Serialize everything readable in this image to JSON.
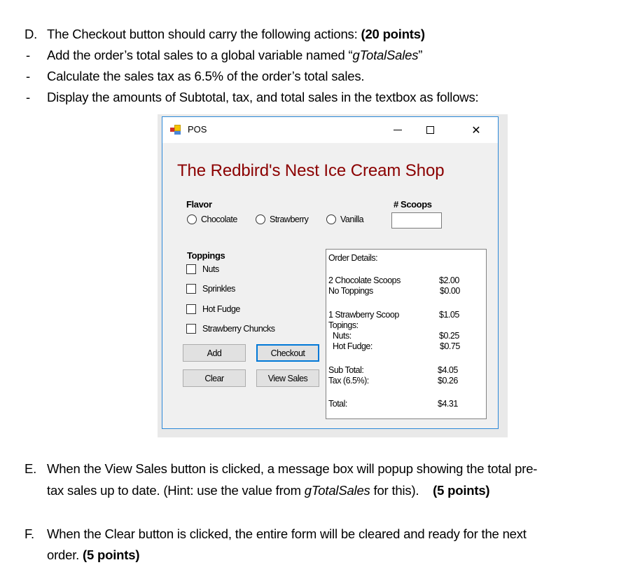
{
  "document": {
    "section_d": {
      "marker": "D.",
      "text": "The Checkout button should carry the following actions: ",
      "points": "(20 points)",
      "bullets": [
        {
          "marker": "-",
          "text_before": "Add the order’s total sales to a global variable named “",
          "italic": "gTotalSales",
          "text_after": "”"
        },
        {
          "marker": "-",
          "text": "Calculate the sales tax as 6.5% of the order’s total sales."
        },
        {
          "marker": "-",
          "text": "Display the amounts of Subtotal, tax, and total sales in the textbox as follows:"
        }
      ]
    },
    "section_e": {
      "marker": "E.",
      "line1": "When the View Sales button is clicked, a message box will popup showing the total pre-",
      "line2_before": "tax sales up to date. (Hint: use the value from ",
      "line2_italic": "gTotalSales",
      "line2_after": " for this).    ",
      "points": "(5 points)"
    },
    "section_f": {
      "marker": "F.",
      "line1": "When the Clear button is clicked, the entire form will be cleared and ready for the next",
      "line2_before": "order. ",
      "points": "(5 points)"
    }
  },
  "window": {
    "title": "POS",
    "icon": "winforms-app-icon",
    "controls": {
      "minimize": "minimize-icon",
      "maximize": "maximize-icon",
      "close": "✕"
    },
    "shop_title": "The Redbird's Nest Ice Cream Shop",
    "title_color": "#8b0000",
    "flavor": {
      "label": "Flavor",
      "options": [
        "Chocolate",
        "Strawberry",
        "Vanilla"
      ],
      "selected": null
    },
    "scoops": {
      "label": "# Scoops",
      "value": ""
    },
    "toppings": {
      "label": "Toppings",
      "options": [
        "Nuts",
        "Sprinkles",
        "Hot Fudge",
        "Strawberry Chuncks"
      ],
      "checked": []
    },
    "buttons": {
      "add": "Add",
      "checkout": "Checkout",
      "clear": "Clear",
      "view_sales": "View Sales"
    },
    "order_details": {
      "header": "Order Details:",
      "lines": [
        {
          "label": "2 Chocolate Scoops",
          "value": "$2.00"
        },
        {
          "label": "No Toppings",
          "value": "$0.00"
        },
        {
          "label": "1 Strawberry Scoop",
          "value": "$1.05"
        },
        {
          "label": "Topings:",
          "value": ""
        },
        {
          "label": " Nuts:",
          "value": "$0.25"
        },
        {
          "label": " Hot Fudge:",
          "value": "$0.75"
        },
        {
          "label": "Sub Total:",
          "value": "$4.05"
        },
        {
          "label": "Tax (6.5%):",
          "value": "$0.26"
        },
        {
          "label": "Total:",
          "value": "$4.31"
        }
      ]
    }
  }
}
